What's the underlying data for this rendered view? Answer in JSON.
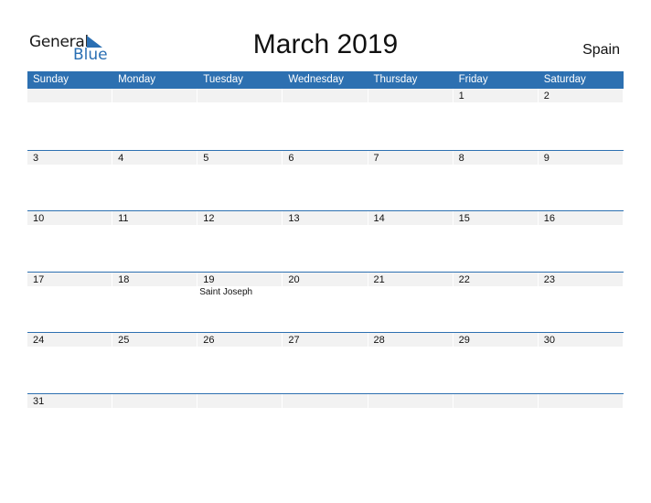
{
  "logo": {
    "text_primary": "General",
    "text_secondary": "Blue"
  },
  "title": "March 2019",
  "country": "Spain",
  "colors": {
    "accent": "#2d70b1",
    "strip": "#f2f2f2"
  },
  "weekdays": [
    "Sunday",
    "Monday",
    "Tuesday",
    "Wednesday",
    "Thursday",
    "Friday",
    "Saturday"
  ],
  "weeks": [
    {
      "days": [
        {
          "num": "",
          "holiday": ""
        },
        {
          "num": "",
          "holiday": ""
        },
        {
          "num": "",
          "holiday": ""
        },
        {
          "num": "",
          "holiday": ""
        },
        {
          "num": "",
          "holiday": ""
        },
        {
          "num": "1",
          "holiday": ""
        },
        {
          "num": "2",
          "holiday": ""
        }
      ]
    },
    {
      "days": [
        {
          "num": "3",
          "holiday": ""
        },
        {
          "num": "4",
          "holiday": ""
        },
        {
          "num": "5",
          "holiday": ""
        },
        {
          "num": "6",
          "holiday": ""
        },
        {
          "num": "7",
          "holiday": ""
        },
        {
          "num": "8",
          "holiday": ""
        },
        {
          "num": "9",
          "holiday": ""
        }
      ]
    },
    {
      "days": [
        {
          "num": "10",
          "holiday": ""
        },
        {
          "num": "11",
          "holiday": ""
        },
        {
          "num": "12",
          "holiday": ""
        },
        {
          "num": "13",
          "holiday": ""
        },
        {
          "num": "14",
          "holiday": ""
        },
        {
          "num": "15",
          "holiday": ""
        },
        {
          "num": "16",
          "holiday": ""
        }
      ]
    },
    {
      "days": [
        {
          "num": "17",
          "holiday": ""
        },
        {
          "num": "18",
          "holiday": ""
        },
        {
          "num": "19",
          "holiday": "Saint Joseph"
        },
        {
          "num": "20",
          "holiday": ""
        },
        {
          "num": "21",
          "holiday": ""
        },
        {
          "num": "22",
          "holiday": ""
        },
        {
          "num": "23",
          "holiday": ""
        }
      ]
    },
    {
      "days": [
        {
          "num": "24",
          "holiday": ""
        },
        {
          "num": "25",
          "holiday": ""
        },
        {
          "num": "26",
          "holiday": ""
        },
        {
          "num": "27",
          "holiday": ""
        },
        {
          "num": "28",
          "holiday": ""
        },
        {
          "num": "29",
          "holiday": ""
        },
        {
          "num": "30",
          "holiday": ""
        }
      ]
    },
    {
      "days": [
        {
          "num": "31",
          "holiday": ""
        },
        {
          "num": "",
          "holiday": ""
        },
        {
          "num": "",
          "holiday": ""
        },
        {
          "num": "",
          "holiday": ""
        },
        {
          "num": "",
          "holiday": ""
        },
        {
          "num": "",
          "holiday": ""
        },
        {
          "num": "",
          "holiday": ""
        }
      ]
    }
  ]
}
